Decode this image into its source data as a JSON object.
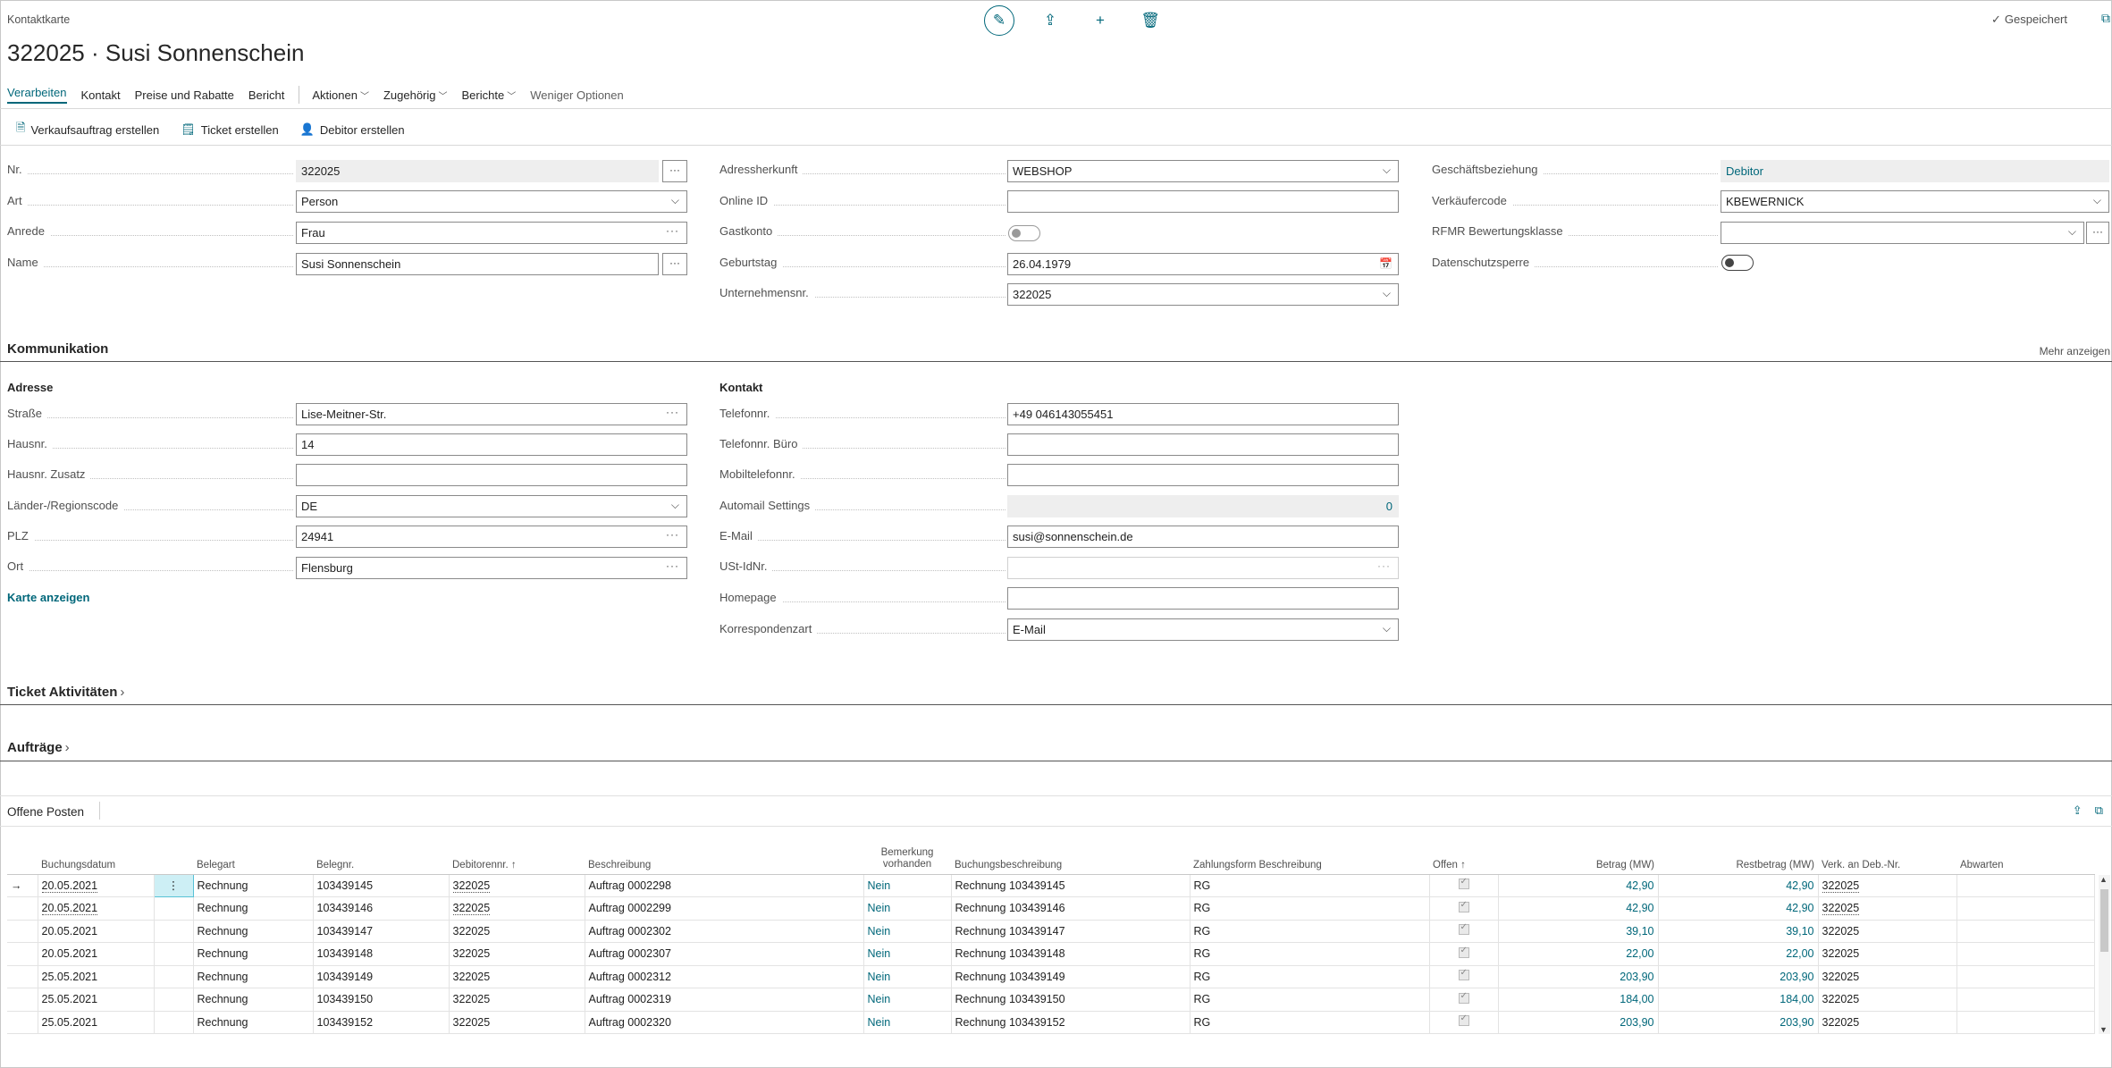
{
  "page": {
    "breadcrumb": "Kontaktkarte",
    "title": "322025 · Susi Sonnenschein",
    "saved_label": "Gespeichert"
  },
  "menu": {
    "items": [
      "Verarbeiten",
      "Kontakt",
      "Preise und Rabatte",
      "Bericht"
    ],
    "dropdowns": [
      "Aktionen",
      "Zugehörig",
      "Berichte"
    ],
    "less_options": "Weniger Optionen"
  },
  "actions": [
    "Verkaufsauftrag erstellen",
    "Ticket erstellen",
    "Debitor erstellen"
  ],
  "general": {
    "nr_label": "Nr.",
    "nr_value": "322025",
    "art_label": "Art",
    "art_value": "Person",
    "anrede_label": "Anrede",
    "anrede_value": "Frau",
    "name_label": "Name",
    "name_value": "Susi Sonnenschein",
    "adressherkunft_label": "Adressherkunft",
    "adressherkunft_value": "WEBSHOP",
    "online_id_label": "Online ID",
    "online_id_value": "",
    "gastkonto_label": "Gastkonto",
    "geburtstag_label": "Geburtstag",
    "geburtstag_value": "26.04.1979",
    "unternehmensnr_label": "Unternehmensnr.",
    "unternehmensnr_value": "322025",
    "geschaeftsbeziehung_label": "Geschäftsbeziehung",
    "geschaeftsbeziehung_value": "Debitor",
    "verkaeufercode_label": "Verkäufercode",
    "verkaeufercode_value": "KBEWERNICK",
    "rfmr_label": "RFMR Bewertungsklasse",
    "rfmr_value": "",
    "datenschutz_label": "Datenschutzsperre"
  },
  "kommunikation": {
    "title": "Kommunikation",
    "mehr": "Mehr anzeigen",
    "adresse_title": "Adresse",
    "strasse_label": "Straße",
    "strasse_value": "Lise-Meitner-Str.",
    "hausnr_label": "Hausnr.",
    "hausnr_value": "14",
    "hausnr_zusatz_label": "Hausnr. Zusatz",
    "hausnr_zusatz_value": "",
    "land_label": "Länder-/Regionscode",
    "land_value": "DE",
    "plz_label": "PLZ",
    "plz_value": "24941",
    "ort_label": "Ort",
    "ort_value": "Flensburg",
    "karte_link": "Karte anzeigen",
    "kontakt_title": "Kontakt",
    "telefon_label": "Telefonnr.",
    "telefon_value": "+49 046143055451",
    "telefon_buero_label": "Telefonnr. Büro",
    "telefon_buero_value": "",
    "mobil_label": "Mobiltelefonnr.",
    "mobil_value": "",
    "automail_label": "Automail Settings",
    "automail_value": "0",
    "email_label": "E-Mail",
    "email_value": "susi@sonnenschein.de",
    "ust_label": "USt-IdNr.",
    "ust_value": "",
    "homepage_label": "Homepage",
    "homepage_value": "",
    "korrespondenz_label": "Korrespondenzart",
    "korrespondenz_value": "E-Mail"
  },
  "sections": {
    "ticket": "Ticket Aktivitäten",
    "auftraege": "Aufträge"
  },
  "grid": {
    "title": "Offene Posten",
    "columns": [
      "Buchungsdatum",
      "Belegart",
      "Belegnr.",
      "Debitorennr. ↑",
      "Beschreibung",
      "Bemerkung vorhanden",
      "Buchungsbeschreibung",
      "Zahlungsform Beschreibung",
      "Offen ↑",
      "Betrag (MW)",
      "Restbetrag (MW)",
      "Verk. an Deb.-Nr.",
      "Abwarten"
    ],
    "rows": [
      {
        "datum": "20.05.2021",
        "art": "Rechnung",
        "nr": "103439145",
        "deb": "322025",
        "beschr": "Auftrag 0002298",
        "bem": "Nein",
        "buchbeschr": "Rechnung 103439145",
        "zf": "RG",
        "betrag": "42,90",
        "rest": "42,90",
        "verk": "322025"
      },
      {
        "datum": "20.05.2021",
        "art": "Rechnung",
        "nr": "103439146",
        "deb": "322025",
        "beschr": "Auftrag 0002299",
        "bem": "Nein",
        "buchbeschr": "Rechnung 103439146",
        "zf": "RG",
        "betrag": "42,90",
        "rest": "42,90",
        "verk": "322025"
      },
      {
        "datum": "20.05.2021",
        "art": "Rechnung",
        "nr": "103439147",
        "deb": "322025",
        "beschr": "Auftrag 0002302",
        "bem": "Nein",
        "buchbeschr": "Rechnung 103439147",
        "zf": "RG",
        "betrag": "39,10",
        "rest": "39,10",
        "verk": "322025"
      },
      {
        "datum": "20.05.2021",
        "art": "Rechnung",
        "nr": "103439148",
        "deb": "322025",
        "beschr": "Auftrag 0002307",
        "bem": "Nein",
        "buchbeschr": "Rechnung 103439148",
        "zf": "RG",
        "betrag": "22,00",
        "rest": "22,00",
        "verk": "322025"
      },
      {
        "datum": "25.05.2021",
        "art": "Rechnung",
        "nr": "103439149",
        "deb": "322025",
        "beschr": "Auftrag 0002312",
        "bem": "Nein",
        "buchbeschr": "Rechnung 103439149",
        "zf": "RG",
        "betrag": "203,90",
        "rest": "203,90",
        "verk": "322025"
      },
      {
        "datum": "25.05.2021",
        "art": "Rechnung",
        "nr": "103439150",
        "deb": "322025",
        "beschr": "Auftrag 0002319",
        "bem": "Nein",
        "buchbeschr": "Rechnung 103439150",
        "zf": "RG",
        "betrag": "184,00",
        "rest": "184,00",
        "verk": "322025"
      },
      {
        "datum": "25.05.2021",
        "art": "Rechnung",
        "nr": "103439152",
        "deb": "322025",
        "beschr": "Auftrag 0002320",
        "bem": "Nein",
        "buchbeschr": "Rechnung 103439152",
        "zf": "RG",
        "betrag": "203,90",
        "rest": "203,90",
        "verk": "322025"
      }
    ]
  },
  "colors": {
    "accent": "#00677a",
    "border": "#8a8a8a",
    "readonly": "#eeeeee"
  }
}
